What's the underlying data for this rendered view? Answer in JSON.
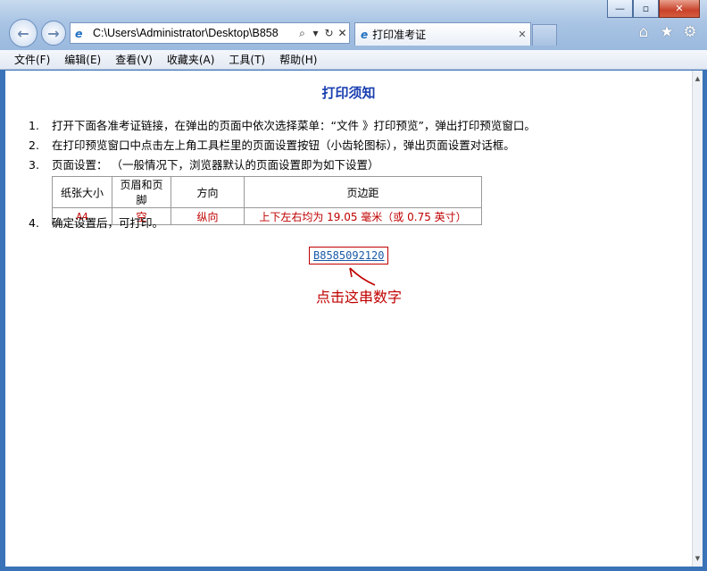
{
  "window": {
    "address": "C:\\Users\\Administrator\\Desktop\\B858",
    "tab_title": "打印准考证",
    "minimize": "—",
    "maximize": "▫",
    "close": "✕"
  },
  "icons": {
    "back": "back-arrow-icon",
    "forward": "forward-arrow-icon",
    "home": "home-icon",
    "favorites": "star-icon",
    "tools": "gear-icon"
  },
  "menu": [
    "文件(F)",
    "编辑(E)",
    "查看(V)",
    "收藏夹(A)",
    "工具(T)",
    "帮助(H)"
  ],
  "page": {
    "title": "打印须知",
    "steps": [
      {
        "num": "1.",
        "text": "打开下面各准考证链接，在弹出的页面中依次选择菜单：“文件 》打印预览”，弹出打印预览窗口。"
      },
      {
        "num": "2.",
        "text": "在打印预览窗口中点击左上角工具栏里的页面设置按钮（小齿轮图标），弹出页面设置对话框。"
      },
      {
        "num": "3.",
        "text": "页面设置：  （一般情况下，浏览器默认的页面设置即为如下设置）"
      },
      {
        "num": "4.",
        "text": "确定设置后，可打印。"
      }
    ],
    "table": {
      "headers": [
        "纸张大小",
        "页眉和页脚",
        "方向",
        "页边距"
      ],
      "values": [
        "A4",
        "空",
        "纵向",
        "上下左右均为 19.05 毫米（或 0.75 英寸）"
      ]
    },
    "exam_link": "B8585092120",
    "hint": "点击这串数字"
  },
  "colors": {
    "title": "#1a3fb0",
    "highlight": "#c00000",
    "link": "#1a5aa8"
  }
}
